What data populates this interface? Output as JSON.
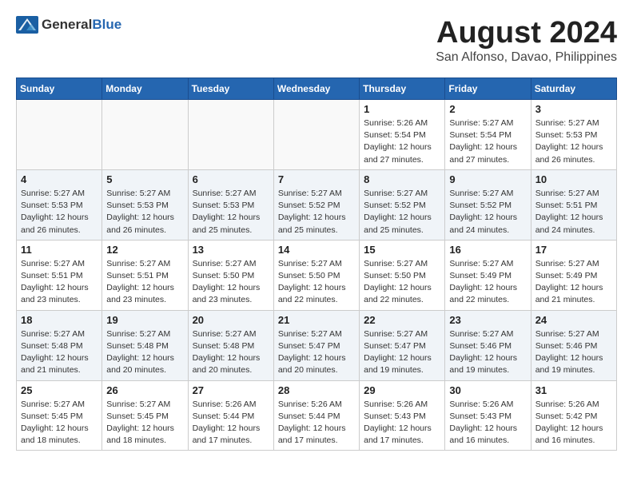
{
  "header": {
    "logo_general": "General",
    "logo_blue": "Blue",
    "month_year": "August 2024",
    "location": "San Alfonso, Davao, Philippines"
  },
  "days_of_week": [
    "Sunday",
    "Monday",
    "Tuesday",
    "Wednesday",
    "Thursday",
    "Friday",
    "Saturday"
  ],
  "weeks": [
    [
      {
        "day": "",
        "info": ""
      },
      {
        "day": "",
        "info": ""
      },
      {
        "day": "",
        "info": ""
      },
      {
        "day": "",
        "info": ""
      },
      {
        "day": "1",
        "info": "Sunrise: 5:26 AM\nSunset: 5:54 PM\nDaylight: 12 hours\nand 27 minutes."
      },
      {
        "day": "2",
        "info": "Sunrise: 5:27 AM\nSunset: 5:54 PM\nDaylight: 12 hours\nand 27 minutes."
      },
      {
        "day": "3",
        "info": "Sunrise: 5:27 AM\nSunset: 5:53 PM\nDaylight: 12 hours\nand 26 minutes."
      }
    ],
    [
      {
        "day": "4",
        "info": "Sunrise: 5:27 AM\nSunset: 5:53 PM\nDaylight: 12 hours\nand 26 minutes."
      },
      {
        "day": "5",
        "info": "Sunrise: 5:27 AM\nSunset: 5:53 PM\nDaylight: 12 hours\nand 26 minutes."
      },
      {
        "day": "6",
        "info": "Sunrise: 5:27 AM\nSunset: 5:53 PM\nDaylight: 12 hours\nand 25 minutes."
      },
      {
        "day": "7",
        "info": "Sunrise: 5:27 AM\nSunset: 5:52 PM\nDaylight: 12 hours\nand 25 minutes."
      },
      {
        "day": "8",
        "info": "Sunrise: 5:27 AM\nSunset: 5:52 PM\nDaylight: 12 hours\nand 25 minutes."
      },
      {
        "day": "9",
        "info": "Sunrise: 5:27 AM\nSunset: 5:52 PM\nDaylight: 12 hours\nand 24 minutes."
      },
      {
        "day": "10",
        "info": "Sunrise: 5:27 AM\nSunset: 5:51 PM\nDaylight: 12 hours\nand 24 minutes."
      }
    ],
    [
      {
        "day": "11",
        "info": "Sunrise: 5:27 AM\nSunset: 5:51 PM\nDaylight: 12 hours\nand 23 minutes."
      },
      {
        "day": "12",
        "info": "Sunrise: 5:27 AM\nSunset: 5:51 PM\nDaylight: 12 hours\nand 23 minutes."
      },
      {
        "day": "13",
        "info": "Sunrise: 5:27 AM\nSunset: 5:50 PM\nDaylight: 12 hours\nand 23 minutes."
      },
      {
        "day": "14",
        "info": "Sunrise: 5:27 AM\nSunset: 5:50 PM\nDaylight: 12 hours\nand 22 minutes."
      },
      {
        "day": "15",
        "info": "Sunrise: 5:27 AM\nSunset: 5:50 PM\nDaylight: 12 hours\nand 22 minutes."
      },
      {
        "day": "16",
        "info": "Sunrise: 5:27 AM\nSunset: 5:49 PM\nDaylight: 12 hours\nand 22 minutes."
      },
      {
        "day": "17",
        "info": "Sunrise: 5:27 AM\nSunset: 5:49 PM\nDaylight: 12 hours\nand 21 minutes."
      }
    ],
    [
      {
        "day": "18",
        "info": "Sunrise: 5:27 AM\nSunset: 5:48 PM\nDaylight: 12 hours\nand 21 minutes."
      },
      {
        "day": "19",
        "info": "Sunrise: 5:27 AM\nSunset: 5:48 PM\nDaylight: 12 hours\nand 20 minutes."
      },
      {
        "day": "20",
        "info": "Sunrise: 5:27 AM\nSunset: 5:48 PM\nDaylight: 12 hours\nand 20 minutes."
      },
      {
        "day": "21",
        "info": "Sunrise: 5:27 AM\nSunset: 5:47 PM\nDaylight: 12 hours\nand 20 minutes."
      },
      {
        "day": "22",
        "info": "Sunrise: 5:27 AM\nSunset: 5:47 PM\nDaylight: 12 hours\nand 19 minutes."
      },
      {
        "day": "23",
        "info": "Sunrise: 5:27 AM\nSunset: 5:46 PM\nDaylight: 12 hours\nand 19 minutes."
      },
      {
        "day": "24",
        "info": "Sunrise: 5:27 AM\nSunset: 5:46 PM\nDaylight: 12 hours\nand 19 minutes."
      }
    ],
    [
      {
        "day": "25",
        "info": "Sunrise: 5:27 AM\nSunset: 5:45 PM\nDaylight: 12 hours\nand 18 minutes."
      },
      {
        "day": "26",
        "info": "Sunrise: 5:27 AM\nSunset: 5:45 PM\nDaylight: 12 hours\nand 18 minutes."
      },
      {
        "day": "27",
        "info": "Sunrise: 5:26 AM\nSunset: 5:44 PM\nDaylight: 12 hours\nand 17 minutes."
      },
      {
        "day": "28",
        "info": "Sunrise: 5:26 AM\nSunset: 5:44 PM\nDaylight: 12 hours\nand 17 minutes."
      },
      {
        "day": "29",
        "info": "Sunrise: 5:26 AM\nSunset: 5:43 PM\nDaylight: 12 hours\nand 17 minutes."
      },
      {
        "day": "30",
        "info": "Sunrise: 5:26 AM\nSunset: 5:43 PM\nDaylight: 12 hours\nand 16 minutes."
      },
      {
        "day": "31",
        "info": "Sunrise: 5:26 AM\nSunset: 5:42 PM\nDaylight: 12 hours\nand 16 minutes."
      }
    ]
  ]
}
